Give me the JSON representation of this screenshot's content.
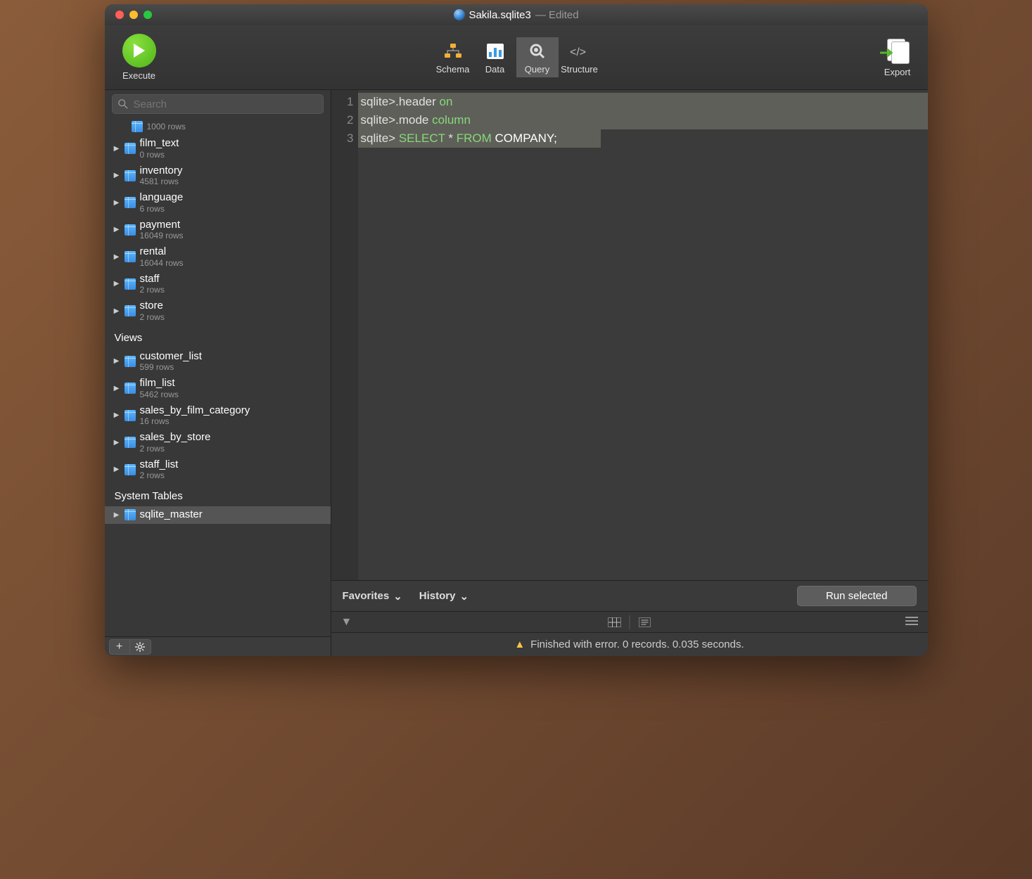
{
  "title": {
    "filename": "Sakila.sqlite3",
    "suffix": "— Edited"
  },
  "toolbar": {
    "execute": "Execute",
    "views": {
      "schema": "Schema",
      "data": "Data",
      "query": "Query",
      "structure": "Structure"
    },
    "export": "Export"
  },
  "search": {
    "placeholder": "Search"
  },
  "tree": {
    "first_sub": "1000 rows",
    "tables": [
      {
        "name": "film_text",
        "sub": "0 rows"
      },
      {
        "name": "inventory",
        "sub": "4581 rows"
      },
      {
        "name": "language",
        "sub": "6 rows"
      },
      {
        "name": "payment",
        "sub": "16049 rows"
      },
      {
        "name": "rental",
        "sub": "16044 rows"
      },
      {
        "name": "staff",
        "sub": "2 rows"
      },
      {
        "name": "store",
        "sub": "2 rows"
      }
    ],
    "views_header": "Views",
    "views": [
      {
        "name": "customer_list",
        "sub": "599 rows"
      },
      {
        "name": "film_list",
        "sub": "5462 rows"
      },
      {
        "name": "sales_by_film_category",
        "sub": "16 rows"
      },
      {
        "name": "sales_by_store",
        "sub": "2 rows"
      },
      {
        "name": "staff_list",
        "sub": "2 rows"
      }
    ],
    "system_header": "System Tables",
    "system": [
      {
        "name": "sqlite_master",
        "sub": ""
      }
    ]
  },
  "editor": {
    "lines": [
      {
        "n": "1",
        "tokens": [
          {
            "t": "sqlite>",
            "c": "c-prompt"
          },
          {
            "t": ".header ",
            "c": "c-cmd"
          },
          {
            "t": "on",
            "c": "c-val"
          }
        ]
      },
      {
        "n": "2",
        "tokens": [
          {
            "t": "sqlite>",
            "c": "c-prompt"
          },
          {
            "t": ".mode ",
            "c": "c-cmd"
          },
          {
            "t": "column",
            "c": "c-val"
          }
        ]
      },
      {
        "n": "3",
        "tokens": [
          {
            "t": "sqlite> ",
            "c": "c-prompt"
          },
          {
            "t": "SELECT ",
            "c": "c-kw"
          },
          {
            "t": "* ",
            "c": "c-star"
          },
          {
            "t": "FROM ",
            "c": "c-kw"
          },
          {
            "t": "COMPANY",
            "c": "c-id"
          },
          {
            "t": ";",
            "c": "c-semi"
          }
        ]
      }
    ]
  },
  "querybar": {
    "favorites": "Favorites",
    "history": "History",
    "run": "Run selected"
  },
  "status": {
    "text": "Finished with error. 0 records. 0.035 seconds."
  }
}
